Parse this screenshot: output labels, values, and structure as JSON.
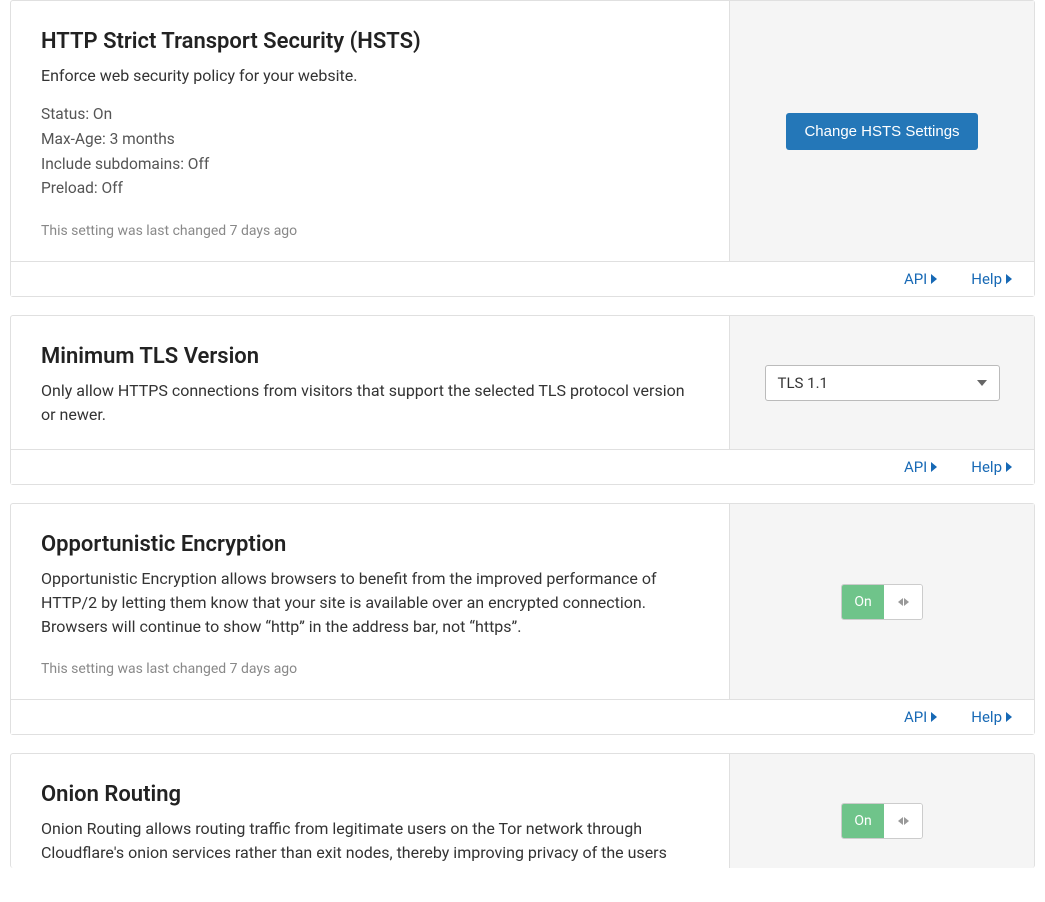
{
  "footer": {
    "api_label": "API",
    "help_label": "Help"
  },
  "hsts": {
    "title": "HTTP Strict Transport Security (HSTS)",
    "description": "Enforce web security policy for your website.",
    "status_line": "Status: On",
    "maxage_line": "Max-Age: 3 months",
    "subdomains_line": "Include subdomains: Off",
    "preload_line": "Preload: Off",
    "last_changed": "This setting was last changed 7 days ago",
    "button_label": "Change HSTS Settings"
  },
  "tls": {
    "title": "Minimum TLS Version",
    "description": "Only allow HTTPS connections from visitors that support the selected TLS protocol version or newer.",
    "selected": "TLS 1.1"
  },
  "opportunistic": {
    "title": "Opportunistic Encryption",
    "description": "Opportunistic Encryption allows browsers to benefit from the improved performance of HTTP/2 by letting them know that your site is available over an encrypted connection. Browsers will continue to show “http” in the address bar, not “https”.",
    "last_changed": "This setting was last changed 7 days ago",
    "toggle_state": "On"
  },
  "onion": {
    "title": "Onion Routing",
    "description": "Onion Routing allows routing traffic from legitimate users on the Tor network through Cloudflare's onion services rather than exit nodes, thereby improving privacy of the users",
    "toggle_state": "On"
  }
}
